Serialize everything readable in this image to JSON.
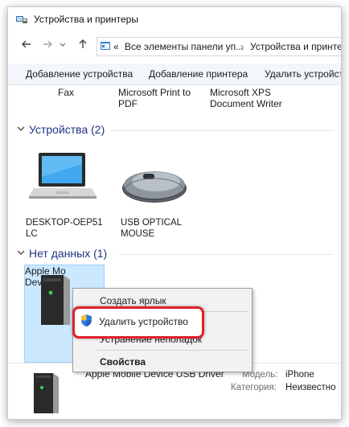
{
  "window": {
    "title": "Устройства и принтеры",
    "icon": "devices-printers-icon"
  },
  "nav": {
    "back_icon": "arrow-left-icon",
    "forward_icon": "arrow-right-icon",
    "dropdown_icon": "chevron-down-icon",
    "up_icon": "arrow-up-icon",
    "breadcrumb_prefix": "«",
    "breadcrumb_1": "Все элементы панели уп...",
    "breadcrumb_sep": "›",
    "breadcrumb_2": "Устройства и принте"
  },
  "toolbar": {
    "add_device": "Добавление устройства",
    "add_printer": "Добавление принтера",
    "remove_device": "Удалить устройст"
  },
  "printers": [
    {
      "label": "Fax"
    },
    {
      "label_line1": "Microsoft Print to",
      "label_line2": "PDF"
    },
    {
      "label_line1": "Microsoft XPS",
      "label_line2": "Document Writer"
    }
  ],
  "groups": {
    "devices": "Устройства (2)",
    "unspecified": "Нет данных (1)"
  },
  "devices": [
    {
      "label_line1": "DESKTOP-OEP51",
      "label_line2": "LC",
      "icon": "laptop-icon"
    },
    {
      "label_line1": "USB OPTICAL",
      "label_line2": "MOUSE",
      "icon": "mouse-icon"
    }
  ],
  "unspecified_device": {
    "label_line1": "Apple Mo",
    "label_line2": "Device US",
    "icon": "external-drive-icon"
  },
  "context_menu": {
    "create_shortcut": "Создать ярлык",
    "remove_device": "Удалить устройство",
    "troubleshoot": "Устранение неполадок",
    "properties": "Свойства"
  },
  "details": {
    "name": "Apple Mobile Device USB Driver",
    "model_key": "Модель:",
    "model_value": "iPhone",
    "category_key": "Категория:",
    "category_value": "Неизвестно"
  },
  "colors": {
    "accent_highlight": "#e0202a",
    "selection_bg": "#cce8ff",
    "group_header_text": "#1e3287"
  }
}
